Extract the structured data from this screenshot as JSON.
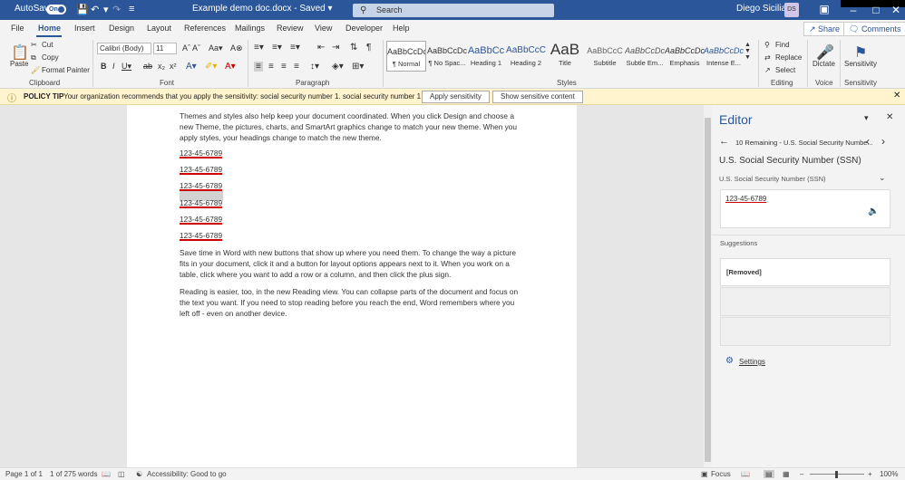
{
  "titlebar": {
    "autosave_label": "AutoSave",
    "autosave_state": "On",
    "doc_title": "Example demo doc.docx - Saved ▾",
    "search_placeholder": "Search",
    "user_name": "Diego Siciliani",
    "user_initials": "DS"
  },
  "tabs": [
    "File",
    "Home",
    "Insert",
    "Design",
    "Layout",
    "References",
    "Mailings",
    "Review",
    "View",
    "Developer",
    "Help"
  ],
  "share_label": "Share",
  "comments_label": "Comments",
  "ribbon": {
    "paste": "Paste",
    "cut": "Cut",
    "copy": "Copy",
    "format_painter": "Format Painter",
    "clipboard_group": "Clipboard",
    "font_name": "Calibri (Body)",
    "font_size": "11",
    "font_group": "Font",
    "paragraph_group": "Paragraph",
    "styles": [
      {
        "preview": "AaBbCcDc",
        "label": "¶ Normal"
      },
      {
        "preview": "AaBbCcDc",
        "label": "¶ No Spac..."
      },
      {
        "preview": "AaBbCc",
        "label": "Heading 1"
      },
      {
        "preview": "AaBbCcC",
        "label": "Heading 2"
      },
      {
        "preview": "AaB",
        "label": "Title"
      },
      {
        "preview": "AaBbCcC",
        "label": "Subtitle"
      },
      {
        "preview": "AaBbCcDc",
        "label": "Subtle Em..."
      },
      {
        "preview": "AaBbCcDc",
        "label": "Emphasis"
      },
      {
        "preview": "AaBbCcDc",
        "label": "Intense E..."
      }
    ],
    "styles_group": "Styles",
    "find": "Find",
    "replace": "Replace",
    "select": "Select",
    "editing_group": "Editing",
    "dictate": "Dictate",
    "voice_group": "Voice",
    "sensitivity": "Sensitivity",
    "sensitivity_group": "Sensitivity"
  },
  "policy": {
    "tag": "POLICY TIP",
    "message": "Your organization recommends that you apply the sensitivity: social security number 1. social security number 1 tool tip",
    "apply_btn": "Apply sensitivity",
    "show_btn": "Show sensitive content"
  },
  "document": {
    "para1": "Themes and styles also help keep your document coordinated. When you click Design and choose a new Theme, the pictures, charts, and SmartArt graphics change to match your new theme. When you apply styles, your headings change to match the new theme.",
    "ssns": [
      "123-45-6789",
      "123-45-6789",
      "123-45-6789",
      "123-45-6789",
      "123-45-6789",
      "123-45-6789"
    ],
    "para2": "Save time in Word with new buttons that show up where you need them. To change the way a picture fits in your document, click it and a button for layout options appears next to it. When you work on a table, click where you want to add a row or a column, and then click the plus sign.",
    "para3": "Reading is easier, too, in the new Reading view. You can collapse parts of the document and focus on the text you want. If you need to stop reading before you reach the end, Word remembers where you left off - even on another device."
  },
  "editor": {
    "title": "Editor",
    "nav_text": "10 Remaining - U.S. Social Security Numbe...",
    "heading": "U.S. Social Security Number (SSN)",
    "sub": "U.S. Social Security Number (SSN)",
    "value": "123-45-6789",
    "suggestions_label": "Suggestions",
    "suggestion": "[Removed]",
    "settings": "Settings"
  },
  "status": {
    "page": "Page 1 of 1",
    "words": "1 of 275 words",
    "accessibility": "Accessibility: Good to go",
    "focus": "Focus",
    "zoom": "100%"
  }
}
